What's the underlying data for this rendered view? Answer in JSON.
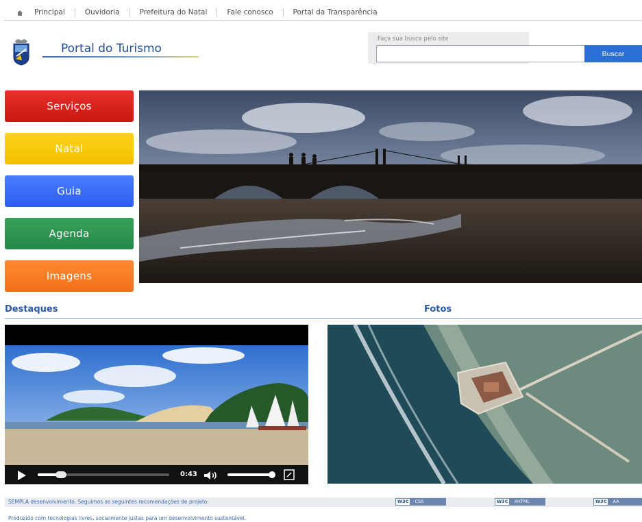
{
  "nav": {
    "items": [
      "Principal",
      "Ouvidoria",
      "Prefeitura do Natal",
      "Fale conosco",
      "Portal da Transparência"
    ]
  },
  "header": {
    "title": "Portal do Turismo",
    "search_label": "Faça sua busca pelo site",
    "search_value": "",
    "search_button": "Buscar"
  },
  "menu": {
    "items": [
      "Serviços",
      "Natal",
      "Guia",
      "Agenda",
      "Imagens"
    ]
  },
  "sections": {
    "destaques": "Destaques",
    "fotos": "Fotos"
  },
  "video": {
    "time": "0:43",
    "progress": 0.18,
    "volume": 0.9
  },
  "footer": {
    "line1": "SEMPLA desenvolvimento. Seguimos as seguintes recomendações de projeto:",
    "line2": "Produzido com tecnologias livres, socialmente justas para um desenvolvimento sustentável.",
    "badges": [
      {
        "w3c": "W3C",
        "kind": "CSS"
      },
      {
        "w3c": "W3C",
        "kind": "XHTML"
      },
      {
        "w3c": "W3C",
        "kind": "AA"
      }
    ]
  },
  "colors": {
    "servicos": "#d8231e",
    "natal": "#f8c800",
    "guia": "#3a6cf7",
    "agenda": "#2e9450",
    "imagens": "#f67c25",
    "accent": "#2a5aa8"
  }
}
